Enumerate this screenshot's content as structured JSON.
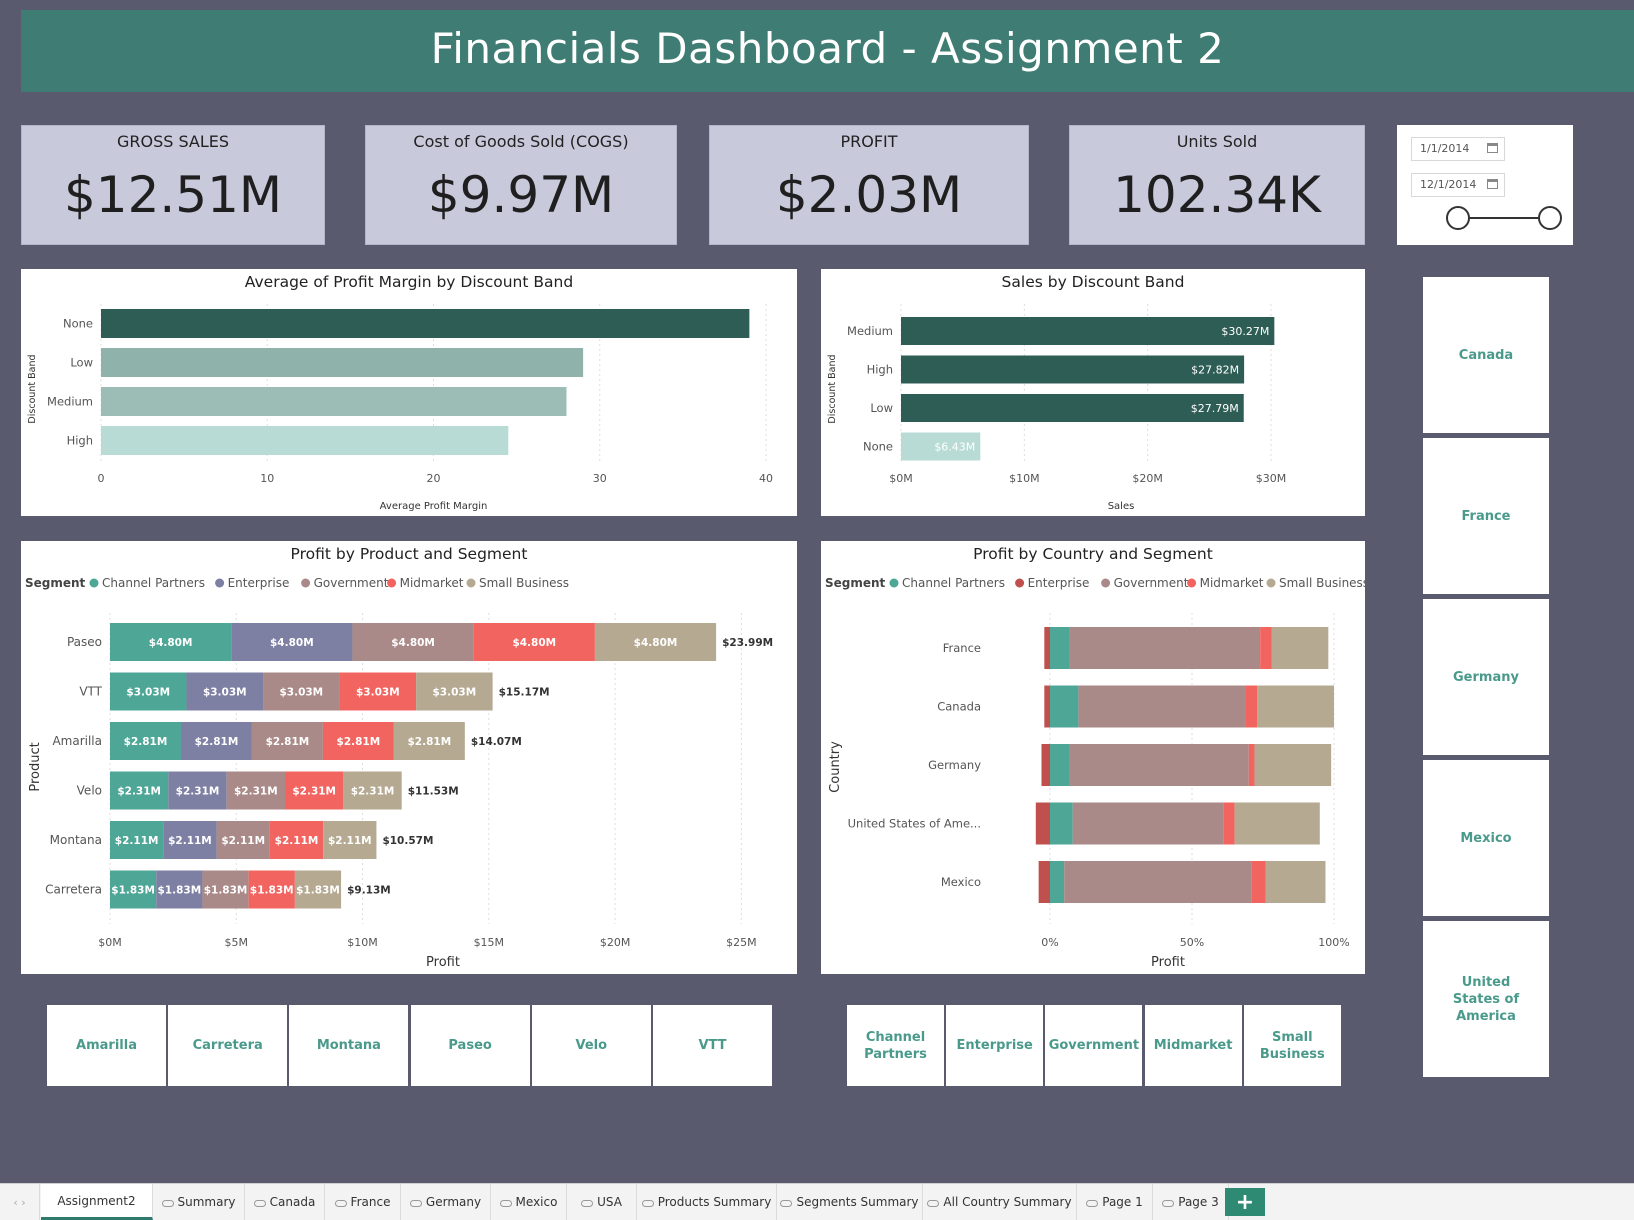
{
  "header": {
    "title": "Financials Dashboard -  Assignment 2"
  },
  "kpis": [
    {
      "label": "GROSS SALES",
      "value": "$12.51M"
    },
    {
      "label": "Cost of Goods Sold (COGS)",
      "value": "$9.97M"
    },
    {
      "label": "PROFIT",
      "value": "$2.03M"
    },
    {
      "label": "Units Sold",
      "value": "102.34K"
    }
  ],
  "date_slicer": {
    "start": "1/1/2014",
    "end": "12/1/2014",
    "range_fraction": [
      0,
      1
    ]
  },
  "colors": {
    "channel_partners": "#4ea697",
    "enterprise": "#7d7fa3",
    "government": "#a98a88",
    "midmarket": "#f2645f",
    "small_business": "#b5a992",
    "country_enterprise": "#c0504d",
    "discount_dark": "#2e5d55"
  },
  "chart_data": [
    {
      "type": "bar",
      "title": "Average of Profit Margin by Discount Band",
      "xlabel": "Average Profit Margin",
      "ylabel": "Discount Band",
      "categories": [
        "None",
        "Low",
        "Medium",
        "High"
      ],
      "values": [
        39,
        29,
        28,
        24.5
      ],
      "colors": [
        "#2e5d55",
        "#8fb2aa",
        "#9cbdb5",
        "#b8dcd5"
      ],
      "xlim": [
        0,
        40
      ],
      "ticks": [
        "0",
        "10",
        "20",
        "30",
        "40"
      ],
      "grid": true
    },
    {
      "type": "bar",
      "title": "Sales by Discount Band",
      "xlabel": "Sales",
      "ylabel": "Discount Band",
      "categories": [
        "Medium",
        "High",
        "Low",
        "None"
      ],
      "values": [
        30.27,
        27.82,
        27.79,
        6.43
      ],
      "labels": [
        "$30.27M",
        "$27.82M",
        "$27.79M",
        "$6.43M"
      ],
      "colors": [
        "#2e5d55",
        "#2e5d55",
        "#2e5d55",
        "#b8dcd5"
      ],
      "xlim": [
        0,
        33
      ],
      "ticks": [
        "$0M",
        "$10M",
        "$20M",
        "$30M"
      ],
      "grid": true
    },
    {
      "type": "bar",
      "title": "Profit by Product and Segment",
      "legend_title": "Segment",
      "legend": [
        "Channel Partners",
        "Enterprise",
        "Government",
        "Midmarket",
        "Small Business"
      ],
      "xlabel": "Profit",
      "ylabel": "Product",
      "categories": [
        "Paseo",
        "VTT",
        "Amarilla",
        "Velo",
        "Montana",
        "Carretera"
      ],
      "segment_labels": [
        "$4.80M",
        "$3.03M",
        "$2.81M",
        "$2.31M",
        "$2.11M",
        "$1.83M"
      ],
      "segment_values": [
        4.8,
        3.03,
        2.81,
        2.31,
        2.11,
        1.83
      ],
      "totals": [
        "$23.99M",
        "$15.17M",
        "$14.07M",
        "$11.53M",
        "$10.57M",
        "$9.13M"
      ],
      "xlim": [
        0,
        25.5
      ],
      "ticks": [
        "$0M",
        "$5M",
        "$10M",
        "$15M",
        "$20M",
        "$25M"
      ],
      "grid": true
    },
    {
      "type": "bar",
      "title": "Profit by Country and Segment",
      "legend_title": "Segment",
      "legend": [
        "Channel Partners",
        "Enterprise",
        "Government",
        "Midmarket",
        "Small Business"
      ],
      "xlabel": "Profit",
      "ylabel": "Country",
      "categories": [
        "France",
        "Canada",
        "Germany",
        "United States of Ame...",
        "Mexico"
      ],
      "series": [
        {
          "name": "Enterprise",
          "values": [
            -2,
            -2,
            -3,
            -5,
            -4
          ]
        },
        {
          "name": "Channel Partners",
          "values": [
            7,
            10,
            7,
            8,
            5
          ]
        },
        {
          "name": "Government",
          "values": [
            67,
            59,
            63,
            53,
            66
          ]
        },
        {
          "name": "Midmarket",
          "values": [
            4,
            4,
            2,
            4,
            5
          ]
        },
        {
          "name": "Small Business",
          "values": [
            20,
            27,
            27,
            30,
            21
          ]
        }
      ],
      "xlim": [
        -5,
        100
      ],
      "ticks": [
        "0%",
        "50%",
        "100%"
      ],
      "grid": true
    }
  ],
  "country_slicer": [
    "Canada",
    "France",
    "Germany",
    "Mexico",
    "United States of America"
  ],
  "product_slicer": [
    "Amarilla",
    "Carretera",
    "Montana",
    "Paseo",
    "Velo",
    "VTT"
  ],
  "segment_slicer": [
    "Channel Partners",
    "Enterprise",
    "Government",
    "Midmarket",
    "Small Business"
  ],
  "tabs": [
    "Assignment2",
    "Summary",
    "Canada",
    "France",
    "Germany",
    "Mexico",
    "USA",
    "Products Summary",
    "Segments Summary",
    "All Country Summary",
    "Page 1",
    "Page 3"
  ],
  "add_tab_label": "+"
}
